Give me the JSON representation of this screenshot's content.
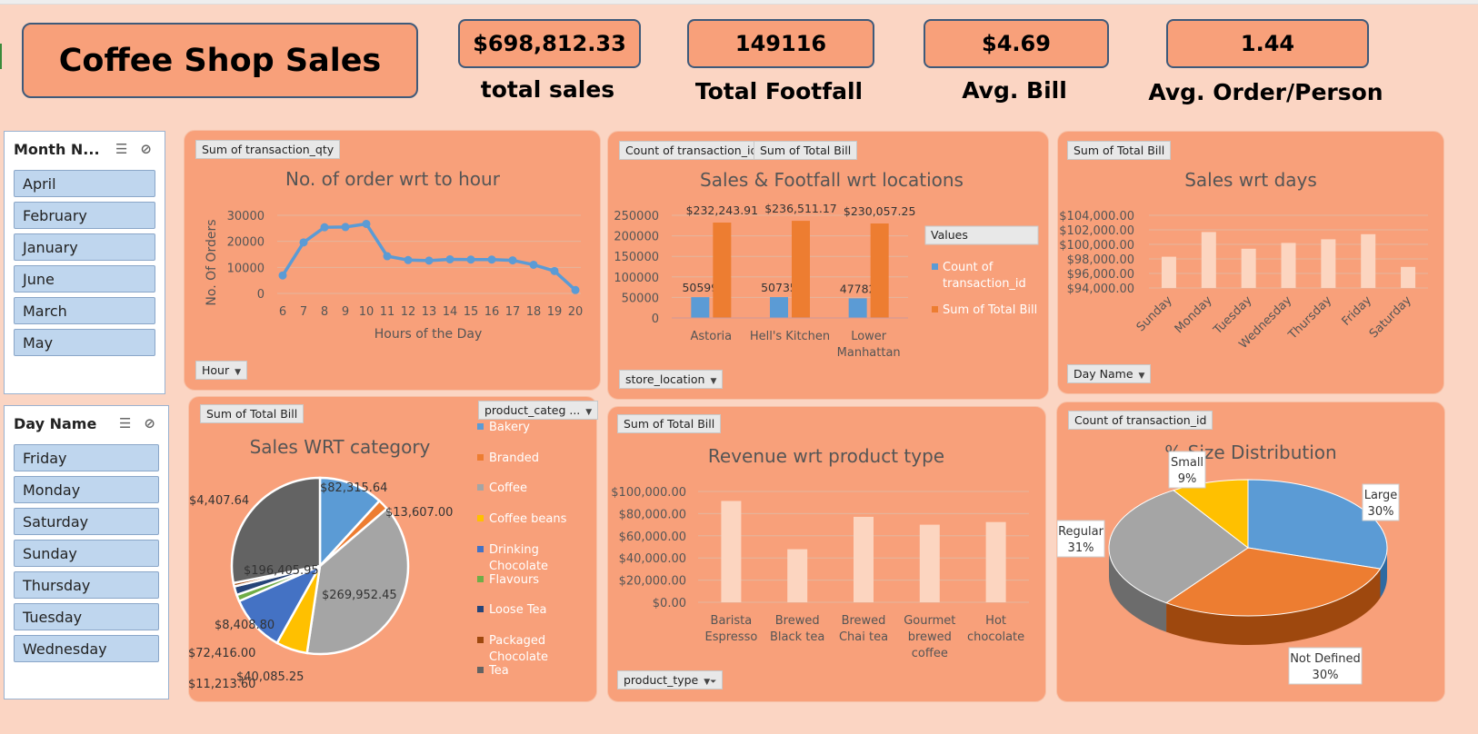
{
  "dashboard": {
    "title": "Coffee Shop Sales",
    "kpis": [
      {
        "value": "$698,812.33",
        "label": "total sales"
      },
      {
        "value": "149116",
        "label": "Total Footfall"
      },
      {
        "value": "$4.69",
        "label": "Avg. Bill"
      },
      {
        "value": "1.44",
        "label": "Avg. Order/Person"
      }
    ]
  },
  "slicers": {
    "month": {
      "title": "Month N...",
      "items": [
        "April",
        "February",
        "January",
        "June",
        "March",
        "May"
      ]
    },
    "day": {
      "title": "Day Name",
      "items": [
        "Friday",
        "Monday",
        "Saturday",
        "Sunday",
        "Thursday",
        "Tuesday",
        "Wednesday"
      ]
    }
  },
  "panels": {
    "hour": {
      "field": "Sum of transaction_qty",
      "filter": "Hour"
    },
    "locations": {
      "field1": "Count of transaction_id",
      "field2": "Sum of Total Bill",
      "filter": "store_location"
    },
    "days": {
      "field": "Sum of Total Bill",
      "filter": "Day Name"
    },
    "category": {
      "field": "Sum of Total Bill",
      "filter": "product_categ ..."
    },
    "product_type": {
      "field": "Sum of Total Bill",
      "filter": "product_type"
    },
    "size": {
      "field": "Count of transaction_id"
    }
  },
  "colors": {
    "accent": "#f8a07a",
    "background": "#fbd5c3",
    "blue": "#5b9bd5",
    "orange": "#ed7d31",
    "gray": "#a5a5a5",
    "gold": "#ffc000",
    "darkgray": "#636363",
    "lightbar": "#fcd5c0"
  },
  "chart_data": [
    {
      "id": "hour",
      "type": "line",
      "title": "No. of order wrt to hour",
      "xlabel": "Hours of the Day",
      "ylabel": "No. Of Orders",
      "x": [
        6,
        7,
        8,
        9,
        10,
        11,
        12,
        13,
        14,
        15,
        16,
        17,
        18,
        19,
        20
      ],
      "values": [
        6900,
        19600,
        25400,
        25500,
        26700,
        14300,
        12800,
        12600,
        13100,
        13000,
        13000,
        12700,
        11000,
        8600,
        1300
      ],
      "ylim": [
        0,
        30000
      ],
      "yticks": [
        "30000",
        "20000",
        "10000",
        "0"
      ]
    },
    {
      "id": "locations",
      "type": "bar",
      "title": "Sales & Footfall wrt locations",
      "categories": [
        "Astoria",
        "Hell's Kitchen",
        "Lower Manhattan"
      ],
      "legend_title": "Values",
      "series": [
        {
          "name": "Count of transaction_id",
          "values": [
            50599,
            50735,
            47782
          ],
          "labels": [
            "50599",
            "50735",
            "47782"
          ]
        },
        {
          "name": "Sum of Total Bill",
          "values": [
            232243.91,
            236511.17,
            230057.25
          ],
          "labels": [
            "$232,243.91",
            "$236,511.17",
            "$230,057.25"
          ]
        }
      ],
      "ylim": [
        0,
        250000
      ],
      "yticks": [
        "250000",
        "200000",
        "150000",
        "100000",
        "50000",
        "0"
      ]
    },
    {
      "id": "days",
      "type": "bar",
      "title": "Sales wrt days",
      "categories": [
        "Sunday",
        "Monday",
        "Tuesday",
        "Wednesday",
        "Thursday",
        "Friday",
        "Saturday"
      ],
      "values": [
        98300,
        101700,
        99400,
        100200,
        100700,
        101400,
        96900
      ],
      "ylim": [
        94000,
        104000
      ],
      "yticks": [
        "$104,000.00",
        "$102,000.00",
        "$100,000.00",
        "$98,000.00",
        "$96,000.00",
        "$94,000.00"
      ]
    },
    {
      "id": "category",
      "type": "pie",
      "title": "Sales WRT category",
      "categories": [
        "Bakery",
        "Branded",
        "Coffee",
        "Coffee beans",
        "Drinking Chocolate",
        "Flavours",
        "Loose Tea",
        "Packaged Chocolate",
        "Tea"
      ],
      "values": [
        82315.64,
        13607.0,
        269952.45,
        40085.25,
        72416.0,
        8408.8,
        11213.6,
        4407.64,
        196405.95
      ],
      "labels": [
        "$82,315.64",
        "$13,607.00",
        "$269,952.45",
        "$40,085.25",
        "$72,416.00",
        "$8,408.80",
        "$11,213.60",
        "$4,407.64",
        "$196,405.95"
      ]
    },
    {
      "id": "product_type",
      "type": "bar",
      "title": "Revenue wrt product type",
      "categories": [
        "Barista Espresso",
        "Brewed Black tea",
        "Brewed Chai tea",
        "Gourmet brewed coffee",
        "Hot chocolate"
      ],
      "values": [
        91400,
        47900,
        77100,
        70000,
        72400
      ],
      "ylim": [
        0,
        100000
      ],
      "yticks": [
        "$100,000.00",
        "$80,000.00",
        "$60,000.00",
        "$40,000.00",
        "$20,000.00",
        "$0.00"
      ]
    },
    {
      "id": "size",
      "type": "pie",
      "title": "% Size Distribution",
      "categories": [
        "Large",
        "Not Defined",
        "Regular",
        "Small"
      ],
      "values": [
        30,
        30,
        31,
        9
      ],
      "labels": [
        "Large 30%",
        "Not Defined 30%",
        "Regular 31%",
        "Small 9%"
      ]
    }
  ]
}
